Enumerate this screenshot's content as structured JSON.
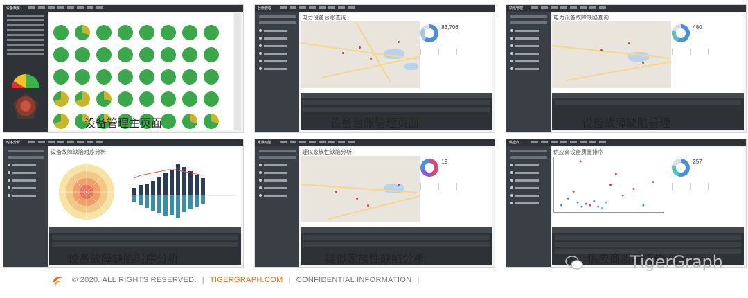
{
  "captions": {
    "c1": "设备管理主页面",
    "c2": "设备台账管理页面",
    "c3": "设备故障缺陷管理",
    "c4": "设备故障缺陷时序分析",
    "c5": "疑似家族性缺陷分析",
    "c6": "供应商质量评价"
  },
  "thumbs": {
    "t1": {
      "brand": "设备概览"
    },
    "t2": {
      "brand": "台账管理",
      "title": "电力设备台账查询",
      "big": "83,706"
    },
    "t3": {
      "brand": "缺陷管理",
      "title": "电力设备故障缺陷查询",
      "big": "480"
    },
    "t4": {
      "brand": "时序分析",
      "title": "设备故障缺陷时序分析"
    },
    "t5": {
      "brand": "家族缺陷",
      "title": "疑似家族性缺陷分析",
      "big": "19"
    },
    "t6": {
      "brand": "供应商",
      "title": "供应商设备质量排序",
      "big": "257"
    }
  },
  "footer": {
    "copyright": "© 2020. ALL RIGHTS RESERVED.",
    "sep1": "|",
    "site": "TIGERGRAPH.COM",
    "sep2": "|",
    "confidential": "CONFIDENTIAL INFORMATION",
    "sep3": "|"
  },
  "watermark": "TigerGraph",
  "colors": {
    "accent": "#f26b1d",
    "sidebar": "#3a3f45",
    "topbar": "#2f3338"
  }
}
